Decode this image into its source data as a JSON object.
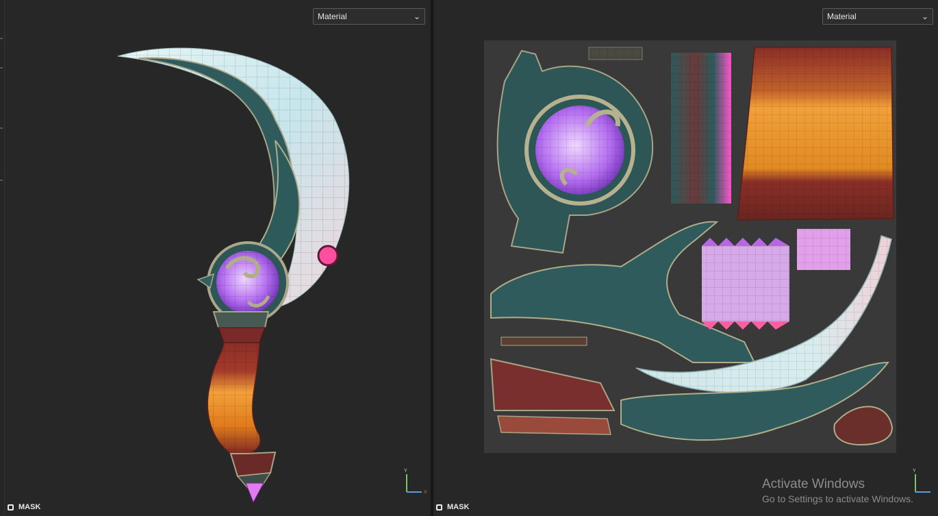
{
  "left_viewport": {
    "dropdown_value": "Material",
    "mask_label": "MASK",
    "axis_x": "X",
    "axis_y": "Y"
  },
  "right_viewport": {
    "dropdown_value": "Material",
    "mask_label": "MASK",
    "axis_y": "Y"
  },
  "activation_notice": {
    "title": "Activate Windows",
    "subtitle": "Go to Settings to activate Windows."
  },
  "colors": {
    "viewport_bg": "#272727",
    "uv_bg": "#393939",
    "teal_metal": "#2f5b5c",
    "blade": "#cfe7ea",
    "orb": "#b070ee",
    "grip_orange": "#e08a22",
    "grip_red": "#8a2e27",
    "pink_gem": "#ff4f9e"
  },
  "icons": [
    "chevron-down-icon",
    "checkbox-icon",
    "axis-gizmo-icon"
  ]
}
